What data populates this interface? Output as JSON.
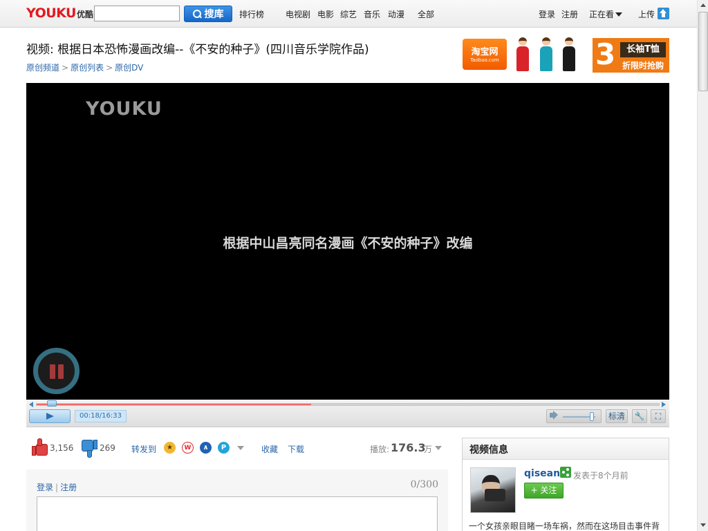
{
  "header": {
    "logo_en": "YOUKU",
    "logo_cn": "优酷",
    "search_placeholder": "",
    "search_button": "搜库",
    "nav": [
      "排行榜",
      "电视剧",
      "电影",
      "综艺",
      "音乐",
      "动漫",
      "全部"
    ],
    "login": "登录",
    "register": "注册",
    "watching": "正在看",
    "upload": "上传"
  },
  "video": {
    "title": "视频: 根据日本恐怖漫画改编--《不安的种子》(四川音乐学院作品)",
    "breadcrumbs": [
      "原创频道",
      "原创列表",
      "原创DV"
    ],
    "breadcrumb_separator": ">"
  },
  "ads": {
    "taobao_name": "淘宝网",
    "taobao_domain": "Taobao.com",
    "sale_number": "3",
    "sale_item": "长袖T恤",
    "sale_text": "折限时抢购"
  },
  "player": {
    "watermark": "YOUKU",
    "subtitle": "根据中山昌亮同名漫画《不安的种子》改编",
    "time": "00:18/16:33",
    "progress_played": 0.018,
    "progress_loaded": 0.44,
    "volume": 0.9,
    "quality": "标清",
    "settings_icon": "wrench-icon",
    "fullscreen_icon": "fullscreen-icon",
    "state": "paused-overlay"
  },
  "actions": {
    "likes": "3,156",
    "dislikes": "269",
    "share_label": "转发到",
    "share_targets": [
      "qzone-icon",
      "weibo-icon",
      "renren-icon",
      "kaixin-icon"
    ],
    "favorite": "收藏",
    "download": "下载",
    "plays_label": "播放:",
    "plays_value": "176.3",
    "plays_unit": "万"
  },
  "comment": {
    "login": "登录",
    "register": "注册",
    "counter": "0/300"
  },
  "info": {
    "heading": "视频信息",
    "uploader": "qisean",
    "posted": "发表于8个月前",
    "follow": "+ 关注",
    "description": "一个女孩亲眼目睹一场车祸，然而在这场目击事件背"
  },
  "colors": {
    "brand_red": "#e5181e",
    "link_blue": "#2a65a8",
    "search_blue": "#1567c8",
    "follow_green": "#3ea52a",
    "progress_red": "#f06868"
  }
}
